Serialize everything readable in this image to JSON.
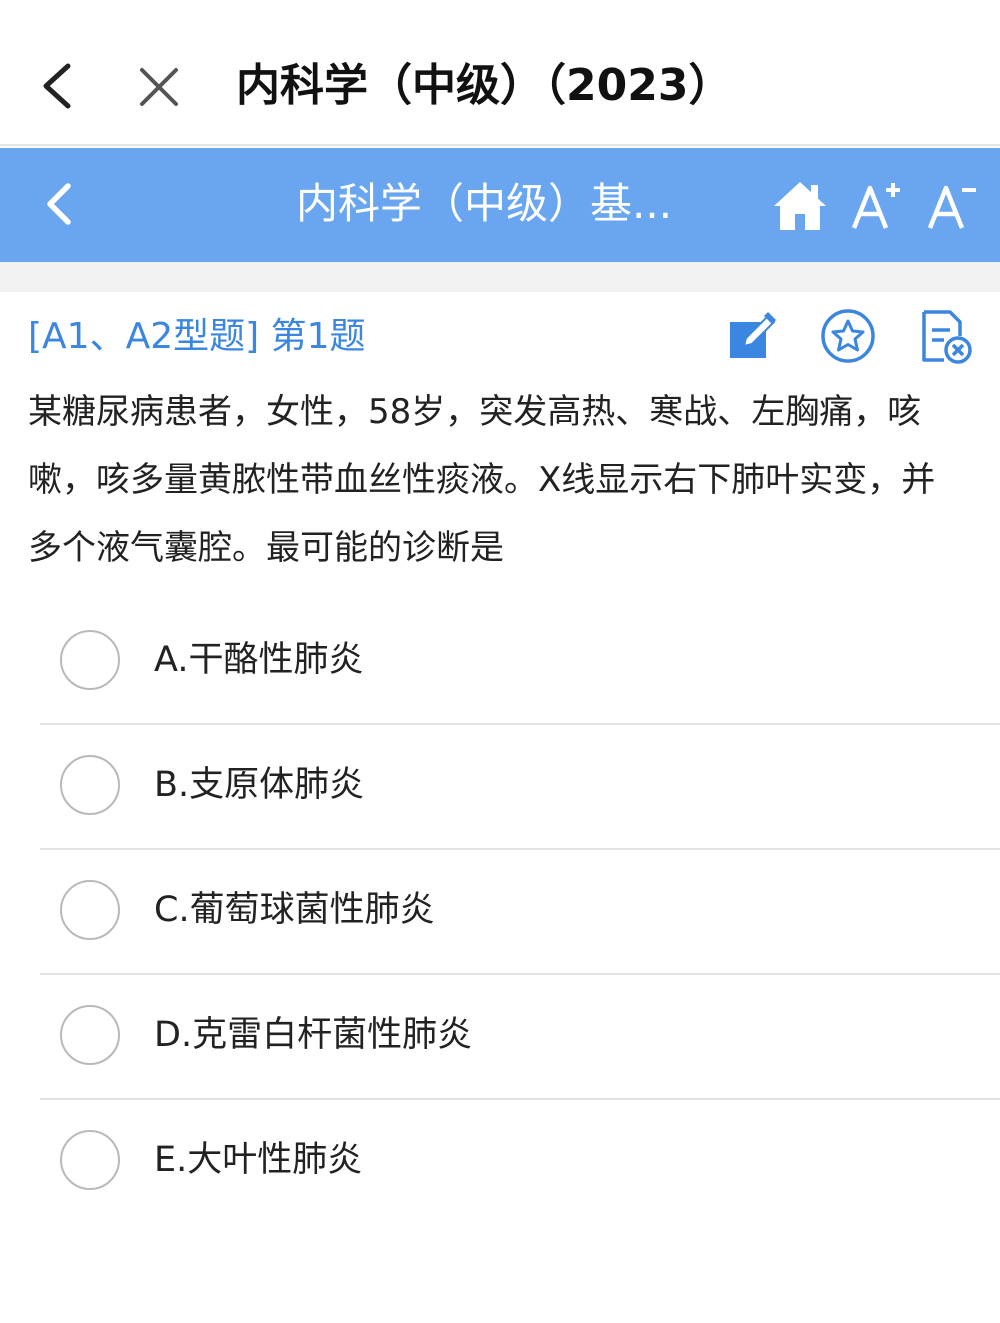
{
  "topbar": {
    "back_icon": "chevron-left-icon",
    "close_icon": "close-icon",
    "title": "内科学（中级）（2023）"
  },
  "toolbar": {
    "back_icon": "chevron-left-icon",
    "title": "内科学（中级）基...",
    "home_icon": "home-icon",
    "font_increase_icon": "font-increase-icon",
    "font_decrease_icon": "font-decrease-icon",
    "color": "#6aa6ef"
  },
  "question": {
    "header": "[A1、A2型题] 第1题",
    "stem": "某糖尿病患者，女性，58岁，突发高热、寒战、左胸痛，咳嗽，咳多量黄脓性带血丝性痰液。X线显示右下肺叶实变，并多个液气囊腔。最可能的诊断是",
    "tools": [
      "edit-icon",
      "favorite-star-icon",
      "remove-question-icon"
    ],
    "accent_color": "#3a86e0",
    "options": [
      {
        "label": "A.干酪性肺炎"
      },
      {
        "label": "B.支原体肺炎"
      },
      {
        "label": "C.葡萄球菌性肺炎"
      },
      {
        "label": "D.克雷白杆菌性肺炎"
      },
      {
        "label": "E.大叶性肺炎"
      }
    ]
  }
}
